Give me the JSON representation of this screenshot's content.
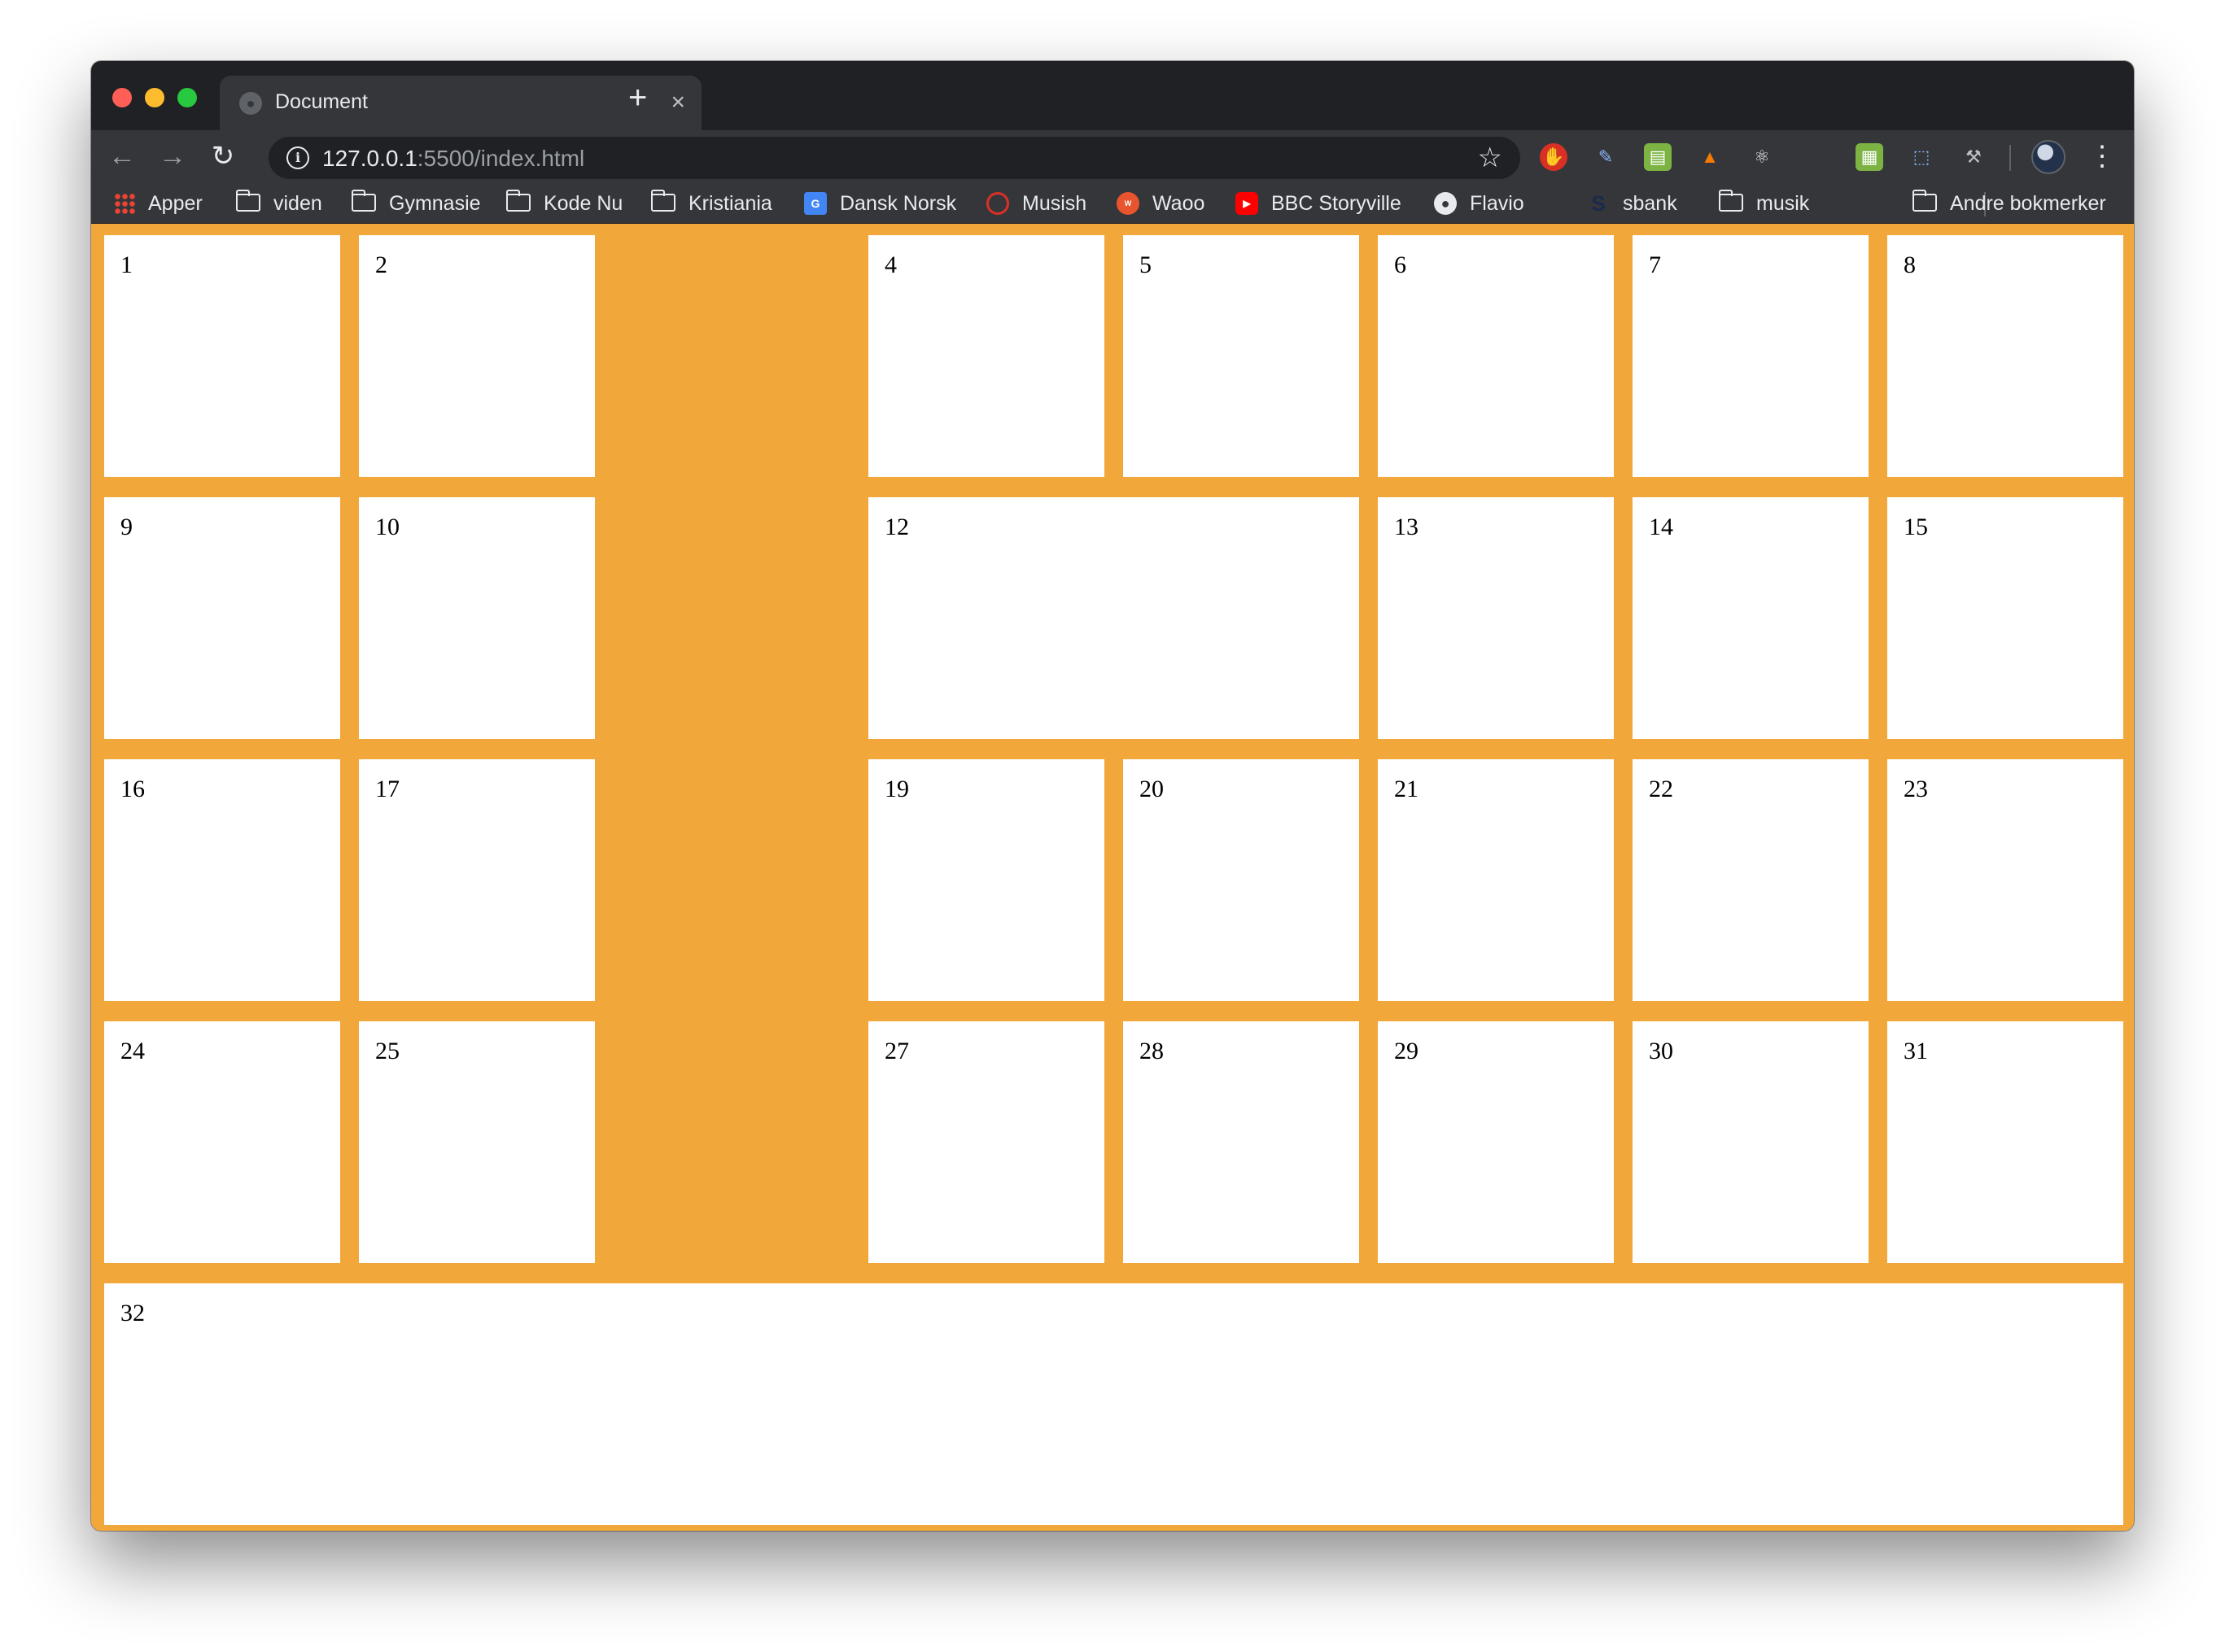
{
  "browser": {
    "tab": {
      "title": "Document",
      "close_glyph": "×"
    },
    "new_tab_glyph": "+",
    "toolbar": {
      "back_glyph": "←",
      "forward_glyph": "→",
      "reload_glyph": "↻",
      "url_host": "127.0.0.1",
      "url_path": ":5500/index.html",
      "star_glyph": "☆",
      "menu_glyph": "⋮"
    },
    "bookmarks": [
      {
        "label": "Apper",
        "icon": "apps-icon"
      },
      {
        "label": "viden",
        "icon": "folder-icon"
      },
      {
        "label": "Gymnasie",
        "icon": "folder-icon"
      },
      {
        "label": "Kode Nu",
        "icon": "folder-icon"
      },
      {
        "label": "Kristiania",
        "icon": "folder-icon"
      },
      {
        "label": "Dansk Norsk",
        "icon": "translate-icon"
      },
      {
        "label": "Musish",
        "icon": "headphones-icon"
      },
      {
        "label": "Waoo",
        "icon": "waoo-icon"
      },
      {
        "label": "BBC Storyville",
        "icon": "youtube-icon"
      },
      {
        "label": "Flavio",
        "icon": "globe-icon"
      },
      {
        "label": "sbank",
        "icon": "sbank-icon"
      },
      {
        "label": "musik",
        "icon": "folder-icon"
      },
      {
        "label": "Andre bokmerker",
        "icon": "folder-icon"
      }
    ]
  },
  "page": {
    "background_color": "#f2a73b",
    "cell_color": "#ffffff",
    "cells": [
      "1",
      "2",
      "4",
      "5",
      "6",
      "7",
      "8",
      "9",
      "10",
      "12",
      "13",
      "14",
      "15",
      "16",
      "17",
      "19",
      "20",
      "21",
      "22",
      "23",
      "24",
      "25",
      "27",
      "28",
      "29",
      "30",
      "31",
      "32"
    ]
  }
}
